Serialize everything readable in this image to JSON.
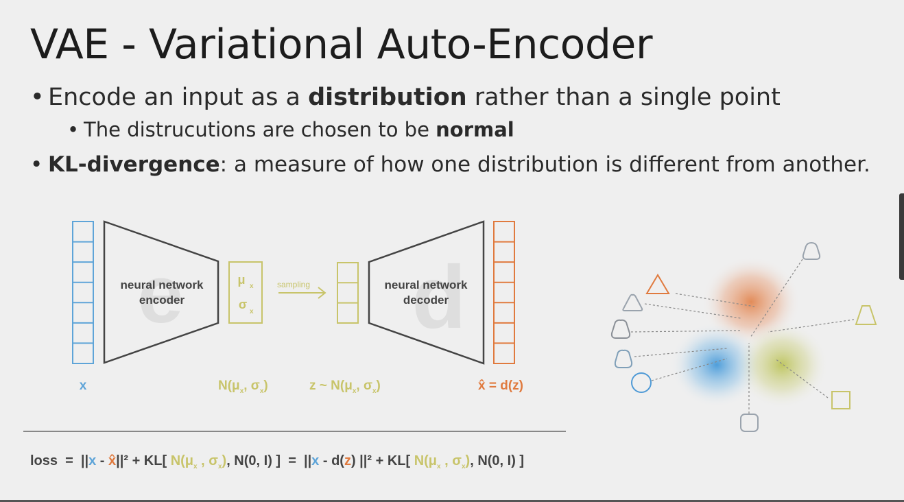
{
  "slide": {
    "title": "VAE - Variational Auto-Encoder",
    "bullets": {
      "b1_pre": "Encode an input as a ",
      "b1_bold": "distribution",
      "b1_post": " rather than a single point",
      "b2_pre": "The distrucutions are chosen to be ",
      "b2_bold": "normal",
      "b3_bold": "KL-divergence",
      "b3_post": ": a measure of how one distribution is different from another."
    }
  },
  "diagram": {
    "encoder_line1": "neural network",
    "encoder_line2": "encoder",
    "decoder_line1": "neural network",
    "decoder_line2": "decoder",
    "encoder_watermark": "e",
    "decoder_watermark": "d",
    "mu": "μ",
    "sigma": "σ",
    "sub_x": "x",
    "sampling": "sampling",
    "input_label": "x",
    "dist_label": "N(μ",
    "dist_label_sigma": ", σ",
    "dist_label_close": ")",
    "z_label": "z ~ N(μ",
    "output_hat": "x̂",
    "output_label": " = d(z)",
    "loss": {
      "lead": "loss  =  ||",
      "x": "x",
      "minus1": " - ",
      "xhat": "x̂",
      "norm_close": "||² + KL[ ",
      "n_mu": "N(μ",
      "n_sep": " , σ",
      "n_close": ")",
      "n01": ", N(0, I) ]  =  ||",
      "x2": "x",
      "minus2": " - d(",
      "z": "z",
      "norm2": ") ||² + KL[ ",
      "n01b": ", N(0, I) ]"
    }
  },
  "colors": {
    "blue": "#5ea4d8",
    "yellow": "#c8c46a",
    "orange": "#e07a3e",
    "gray_text": "#444444",
    "watermark": "#dedede"
  }
}
